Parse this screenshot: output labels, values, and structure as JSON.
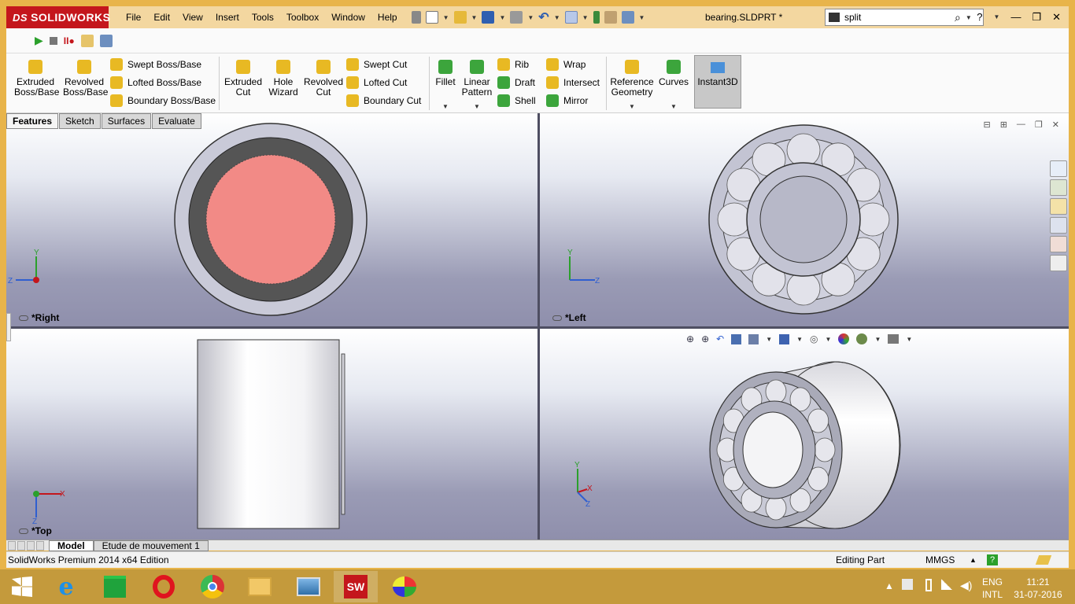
{
  "app": {
    "logo_text": "SOLIDWORKS",
    "logo_prefix": "DS",
    "document_title": "bearing.SLDPRT *",
    "search_value": "split"
  },
  "menu": [
    "File",
    "Edit",
    "View",
    "Insert",
    "Tools",
    "Toolbox",
    "Window",
    "Help"
  ],
  "commands": {
    "extruded_boss": "Extruded\nBoss/Base",
    "revolved_boss": "Revolved\nBoss/Base",
    "swept_boss": "Swept Boss/Base",
    "lofted_boss": "Lofted Boss/Base",
    "boundary_boss": "Boundary Boss/Base",
    "extruded_cut": "Extruded\nCut",
    "hole_wizard": "Hole\nWizard",
    "revolved_cut": "Revolved\nCut",
    "swept_cut": "Swept Cut",
    "lofted_cut": "Lofted Cut",
    "boundary_cut": "Boundary Cut",
    "fillet": "Fillet",
    "linear_pattern": "Linear\nPattern",
    "rib": "Rib",
    "draft": "Draft",
    "shell": "Shell",
    "wrap": "Wrap",
    "intersect": "Intersect",
    "mirror": "Mirror",
    "reference_geometry": "Reference\nGeometry",
    "curves": "Curves",
    "instant3d": "Instant3D"
  },
  "tabs": [
    "Features",
    "Sketch",
    "Surfaces",
    "Evaluate"
  ],
  "viewports": {
    "right": "*Right",
    "left": "*Left",
    "top": "*Top"
  },
  "bottom_tabs": [
    "Model",
    "Etude de mouvement 1"
  ],
  "status": {
    "edition": "SolidWorks Premium 2014 x64 Edition",
    "mode": "Editing Part",
    "units": "MMGS"
  },
  "tray": {
    "lang_top": "ENG",
    "lang_bottom": "INTL",
    "time": "11:21",
    "date": "31-07-2016"
  },
  "colors": {
    "accent_window": "#E8B44A",
    "sw_red": "#C4161C",
    "face_selected": "#F28A86"
  }
}
